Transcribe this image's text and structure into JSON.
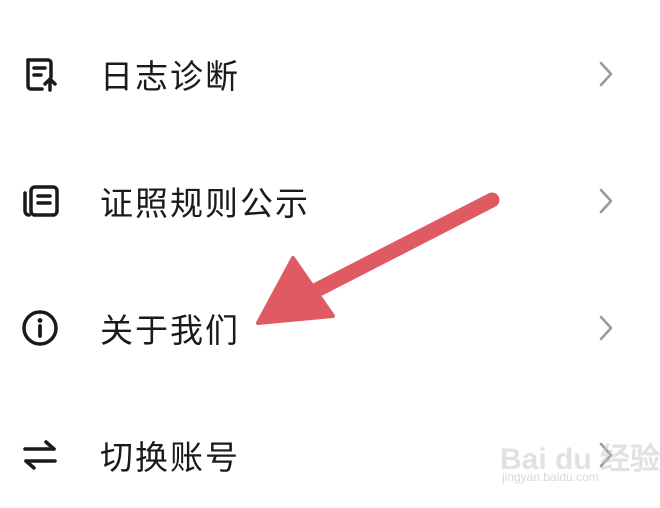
{
  "menu": {
    "items": [
      {
        "label": "日志诊断",
        "icon": "log-document-icon"
      },
      {
        "label": "证照规则公示",
        "icon": "license-cards-icon"
      },
      {
        "label": "关于我们",
        "icon": "info-circle-icon"
      },
      {
        "label": "切换账号",
        "icon": "swap-arrows-icon"
      }
    ]
  },
  "annotation": {
    "arrow_color": "#e05a63",
    "points_to": "关于我们"
  },
  "watermark": {
    "brand": "Bai du 经验",
    "url": "jingyan.baidu.com"
  },
  "colors": {
    "text": "#1a1a1a",
    "icon": "#1a1a1a",
    "chevron": "#9a9a9a",
    "background": "#ffffff"
  }
}
